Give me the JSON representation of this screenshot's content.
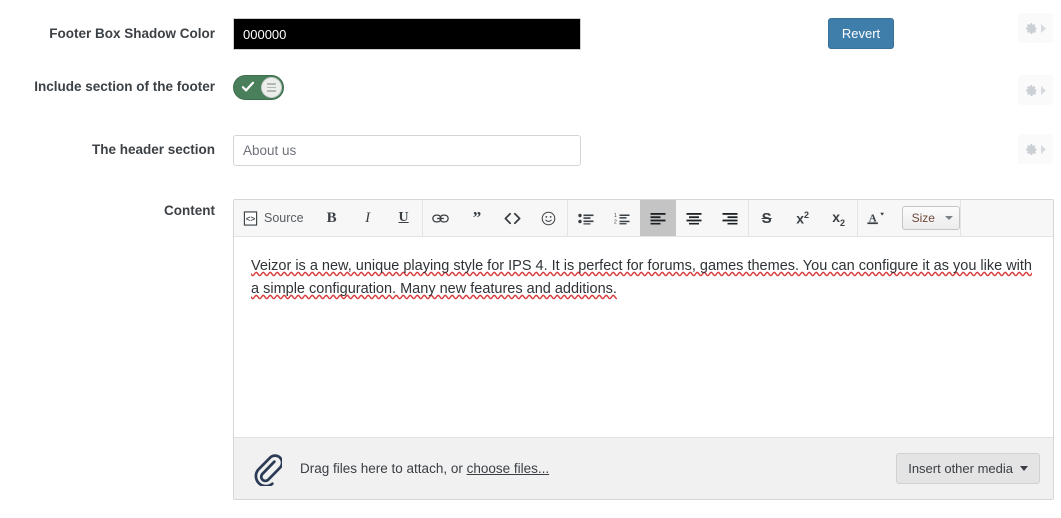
{
  "rows": [
    {
      "label": "Footer Box Shadow Color",
      "value": "000000",
      "revert_label": "Revert"
    },
    {
      "label": "Include section of the footer",
      "toggle_state": "on"
    },
    {
      "label": "The header section",
      "value": "About us"
    },
    {
      "label": "Content"
    }
  ],
  "colors": {
    "swatch": "#000000",
    "revert_button": "#3f7dab",
    "toggle_on": "#4a7f5b",
    "label_text": "#3c4146",
    "spellcheck_underline": "#d83b3b",
    "toolbar_bg": "#f7f7f7",
    "active_button": "#c4c4c4"
  },
  "editor": {
    "toolbar": {
      "groups": [
        {
          "buttons": [
            {
              "name": "source-icon",
              "label": "Source",
              "active": false
            },
            {
              "name": "bold-icon",
              "label": "B",
              "active": false
            },
            {
              "name": "italic-icon",
              "label": "I",
              "active": false
            },
            {
              "name": "underline-icon",
              "label": "U",
              "active": false
            }
          ]
        },
        {
          "buttons": [
            {
              "name": "link-icon",
              "label": "",
              "active": false
            },
            {
              "name": "blockquote-icon",
              "label": "",
              "active": false
            },
            {
              "name": "code-icon",
              "label": "",
              "active": false
            },
            {
              "name": "emoticon-icon",
              "label": "",
              "active": false
            }
          ]
        },
        {
          "buttons": [
            {
              "name": "bulleted-list-icon",
              "label": "",
              "active": false
            },
            {
              "name": "numbered-list-icon",
              "label": "",
              "active": false
            },
            {
              "name": "align-left-icon",
              "label": "",
              "active": true
            },
            {
              "name": "align-center-icon",
              "label": "",
              "active": false
            },
            {
              "name": "align-right-icon",
              "label": "",
              "active": false
            }
          ]
        },
        {
          "buttons": [
            {
              "name": "strikethrough-icon",
              "label": "S",
              "active": false
            },
            {
              "name": "superscript-icon",
              "label": "x2",
              "active": false
            },
            {
              "name": "subscript-icon",
              "label": "x2",
              "active": false
            }
          ]
        },
        {
          "buttons": [
            {
              "name": "text-color-icon",
              "label": "A",
              "active": false
            }
          ],
          "size_select": "Size"
        }
      ]
    },
    "content": {
      "paragraph": "Veizor is a new, unique playing style for IPS 4. It is perfect for forums, games themes. You can configure it as you like with a simple configuration. Many new features and additions."
    },
    "attachments": {
      "drag_text": "Drag files here to attach, or ",
      "choose_files_link": "choose files...",
      "insert_media_label": "Insert other media"
    }
  },
  "settings_buttons": [
    {
      "name": "settings-gear-1"
    },
    {
      "name": "settings-gear-2"
    },
    {
      "name": "settings-gear-3"
    }
  ]
}
